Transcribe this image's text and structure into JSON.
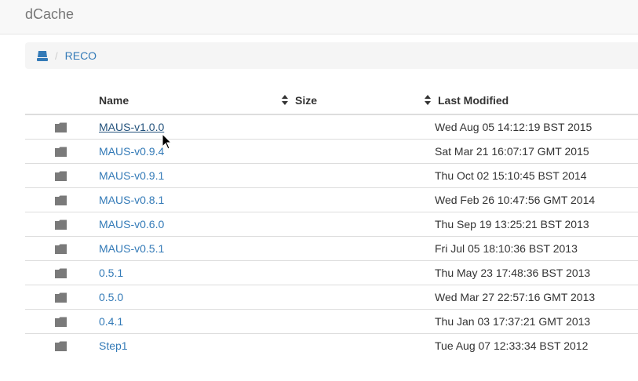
{
  "app": {
    "brand": "dCache"
  },
  "breadcrumb": {
    "home_icon": "drive-icon",
    "separator": "/",
    "current": "RECO"
  },
  "table": {
    "headers": {
      "name": "Name",
      "size": "Size",
      "modified": "Last Modified"
    },
    "sort_icon": "sort-icon",
    "rows": [
      {
        "name": "MAUS-v1.0.0",
        "size": "",
        "modified": "Wed Aug 05 14:12:19 BST 2015",
        "hover": true
      },
      {
        "name": "MAUS-v0.9.4",
        "size": "",
        "modified": "Sat Mar 21 16:07:17 GMT 2015"
      },
      {
        "name": "MAUS-v0.9.1",
        "size": "",
        "modified": "Thu Oct 02 15:10:45 BST 2014"
      },
      {
        "name": "MAUS-v0.8.1",
        "size": "",
        "modified": "Wed Feb 26 10:47:56 GMT 2014"
      },
      {
        "name": "MAUS-v0.6.0",
        "size": "",
        "modified": "Thu Sep 19 13:25:21 BST 2013"
      },
      {
        "name": "MAUS-v0.5.1",
        "size": "",
        "modified": "Fri Jul 05 18:10:36 BST 2013"
      },
      {
        "name": "0.5.1",
        "size": "",
        "modified": "Thu May 23 17:48:36 BST 2013"
      },
      {
        "name": "0.5.0",
        "size": "",
        "modified": "Wed Mar 27 22:57:16 GMT 2013"
      },
      {
        "name": "0.4.1",
        "size": "",
        "modified": "Thu Jan 03 17:37:21 GMT 2013"
      },
      {
        "name": "Step1",
        "size": "",
        "modified": "Tue Aug 07 12:33:34 BST 2012"
      }
    ]
  },
  "colors": {
    "link": "#337ab7",
    "link_hover": "#23527c",
    "folder_icon": "#7a7a7a"
  }
}
